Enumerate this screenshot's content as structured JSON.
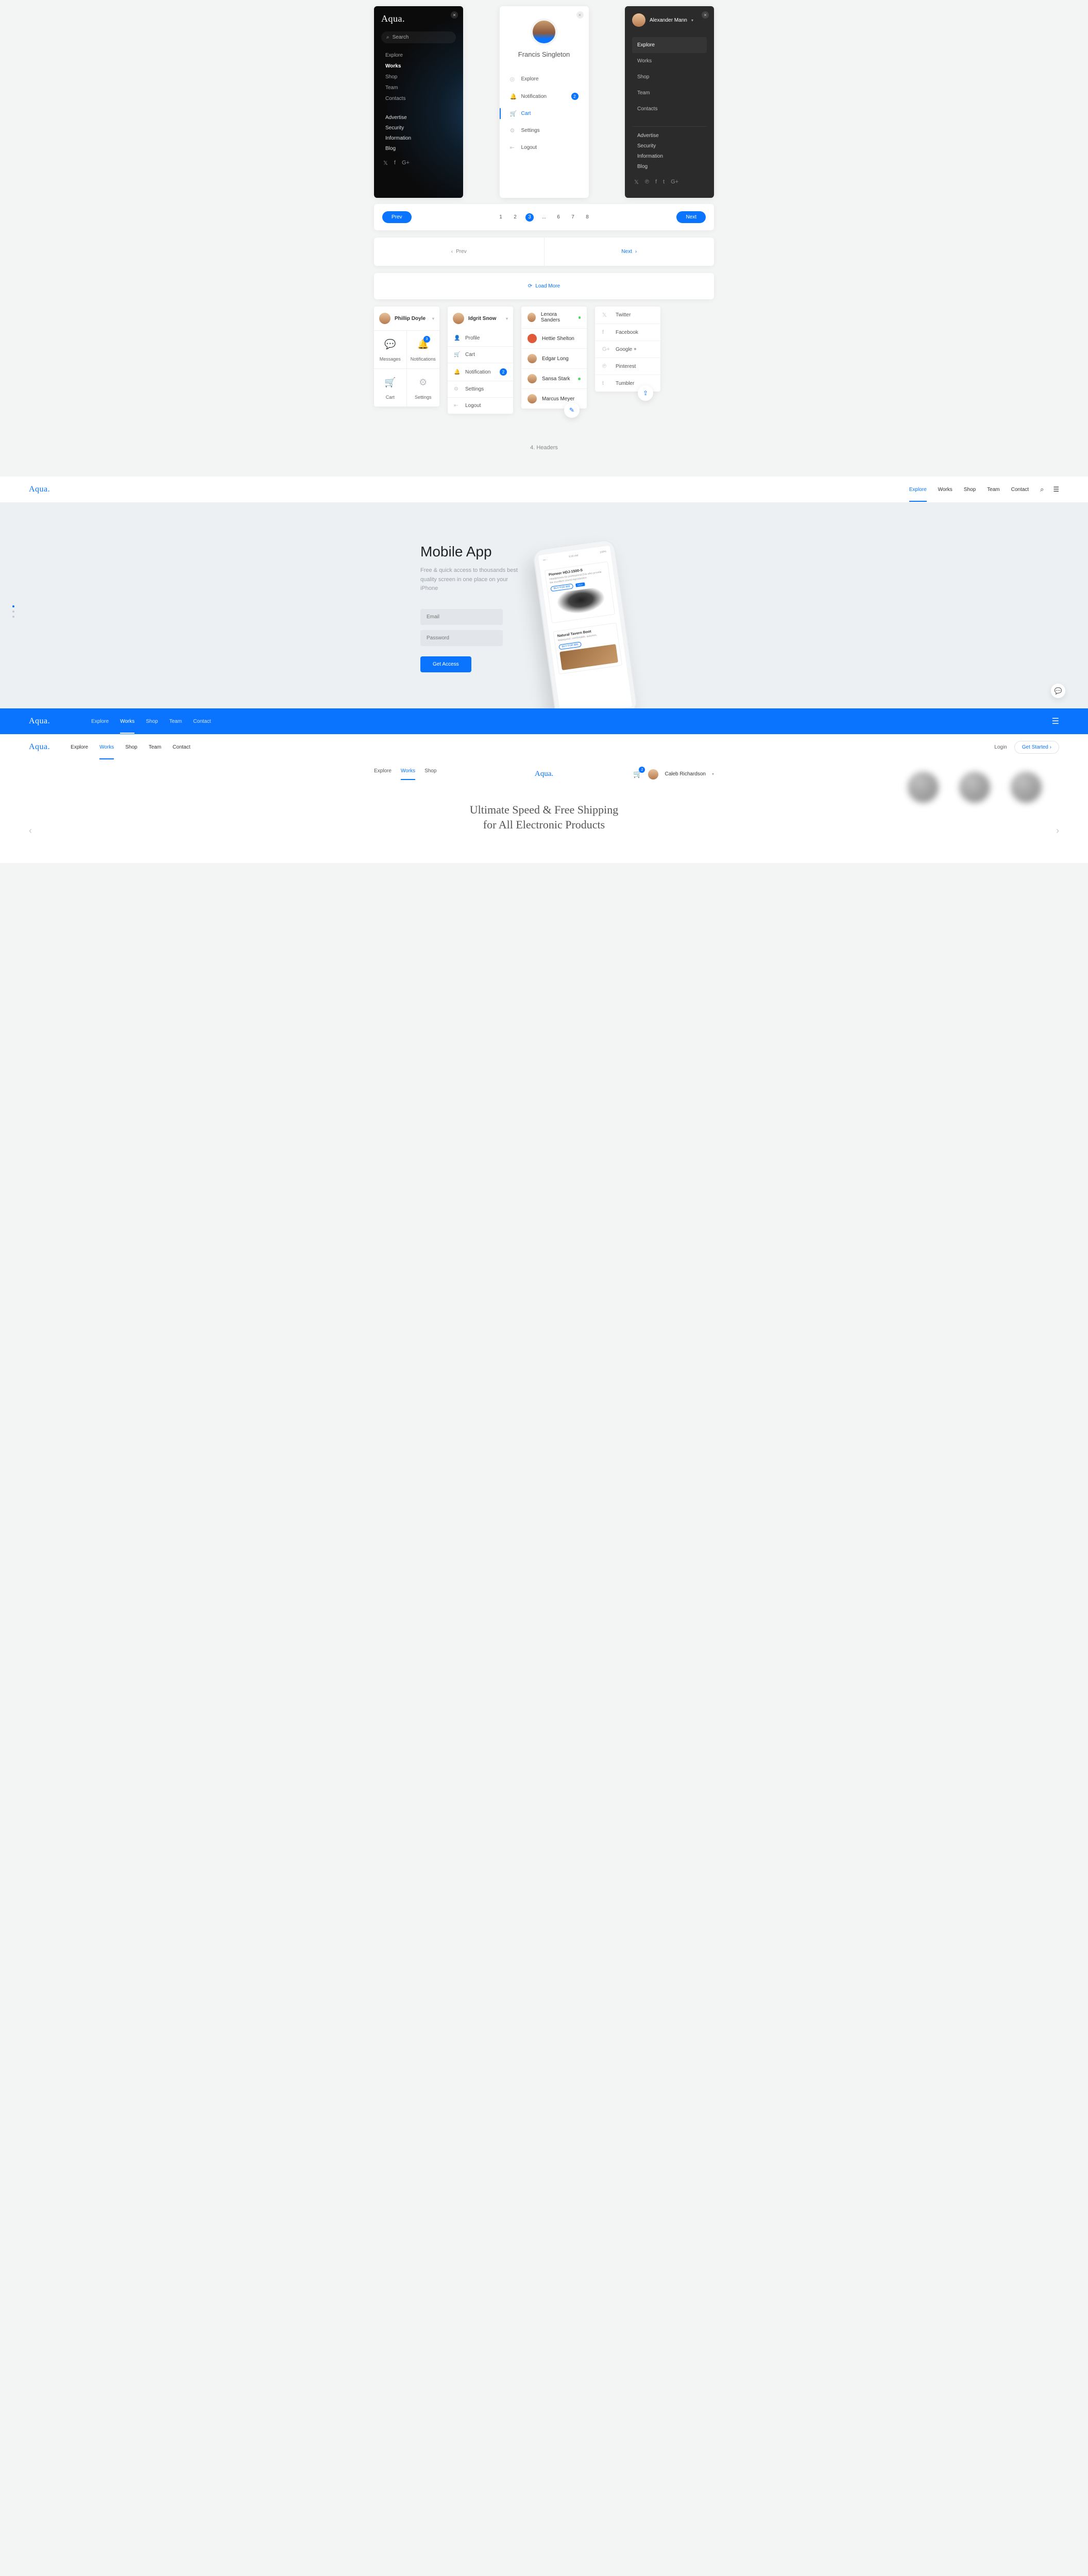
{
  "brand": "Aqua.",
  "panel1": {
    "search_placeholder": "Search",
    "nav": [
      "Explore",
      "Works",
      "Shop",
      "Team",
      "Contacts"
    ],
    "nav_active": 1,
    "secondary": [
      "Advertise",
      "Security",
      "Information",
      "Blog"
    ]
  },
  "panel2": {
    "user_name": "Francis Singleton",
    "menu": [
      {
        "icon": "◎",
        "label": "Explore"
      },
      {
        "icon": "🔔",
        "label": "Notification",
        "badge": "2"
      },
      {
        "icon": "🛒",
        "label": "Cart",
        "active": true
      },
      {
        "icon": "⚙",
        "label": "Settings"
      },
      {
        "icon": "⇤",
        "label": "Logout"
      }
    ]
  },
  "panel3": {
    "user_name": "Alexander Mann",
    "menu": [
      "Explore",
      "Works",
      "Shop",
      "Team",
      "Contacts"
    ],
    "menu_active": 0,
    "secondary": [
      "Advertise",
      "Security",
      "Information",
      "Blog"
    ]
  },
  "pagination": {
    "prev": "Prev",
    "next": "Next",
    "pages": [
      "1",
      "2",
      "3",
      "...",
      "6",
      "7",
      "8"
    ],
    "current_idx": 2,
    "simple_prev": "Prev",
    "simple_next": "Next",
    "load_more": "Load More"
  },
  "dd1": {
    "name": "Phillip Doyle",
    "tiles": [
      {
        "icon": "💬",
        "label": "Messages"
      },
      {
        "icon": "🔔",
        "label": "Notifications",
        "badge": "3"
      },
      {
        "icon": "🛒",
        "label": "Cart"
      },
      {
        "icon": "⚙",
        "label": "Settings"
      }
    ]
  },
  "dd2": {
    "name": "Idgrit Snow",
    "items": [
      {
        "icon": "👤",
        "label": "Profile"
      },
      {
        "icon": "🛒",
        "label": "Cart"
      },
      {
        "icon": "🔔",
        "label": "Notification",
        "badge": "2"
      },
      {
        "icon": "⚙",
        "label": "Settings"
      },
      {
        "icon": "⇤",
        "label": "Logout"
      }
    ]
  },
  "people": [
    {
      "name": "Lenora Sanders",
      "online": true
    },
    {
      "name": "Hettie Shelton",
      "red": true
    },
    {
      "name": "Edgar Long"
    },
    {
      "name": "Sansa Stark",
      "online": true
    },
    {
      "name": "Marcus Meyer"
    }
  ],
  "socials": [
    {
      "icon": "𝕏",
      "label": "Twitter"
    },
    {
      "icon": "f",
      "label": "Facebook"
    },
    {
      "icon": "G+",
      "label": "Google +"
    },
    {
      "icon": "℗",
      "label": "Pinterest"
    },
    {
      "icon": "t",
      "label": "Tumbler"
    }
  ],
  "section_title": "4. Headers",
  "header1": {
    "nav": [
      "Explore",
      "Works",
      "Shop",
      "Team",
      "Contact"
    ],
    "active": 0
  },
  "hero": {
    "title": "Mobile App",
    "sub": "Free & quick access to thousands best quality screen in one place on your iPhone",
    "email_ph": "Email",
    "pass_ph": "Password",
    "cta": "Get Access",
    "phone": {
      "time": "9:30 AM",
      "batt": "100%",
      "p1_title": "Pioneer HDJ-1500-S",
      "p1_sub": "Headphones for professional DJs who provide the excellent sound reproduction",
      "p1_buy": "BUY FOR $99",
      "p1_tag": "SALE",
      "p2_title": "Natural Tavern Boot",
      "p2_sub": "Waterproof, comfortable, autumns.",
      "p2_buy": "BUY FOR $95"
    }
  },
  "header2": {
    "nav": [
      "Explore",
      "Works",
      "Shop",
      "Team",
      "Contact"
    ],
    "active": 1
  },
  "header3": {
    "nav": [
      "Explore",
      "Works",
      "Shop",
      "Team",
      "Contact"
    ],
    "active": 1,
    "login": "Login",
    "cta": "Get Started"
  },
  "header4": {
    "leftnav": [
      "Explore",
      "Works",
      "Shop"
    ],
    "active": 1,
    "cart_count": "2",
    "user": "Caleb Richardson"
  },
  "product_hero": {
    "line1": "Ultimate Speed & Free Shipping",
    "line2": "for All Electronic Products"
  }
}
